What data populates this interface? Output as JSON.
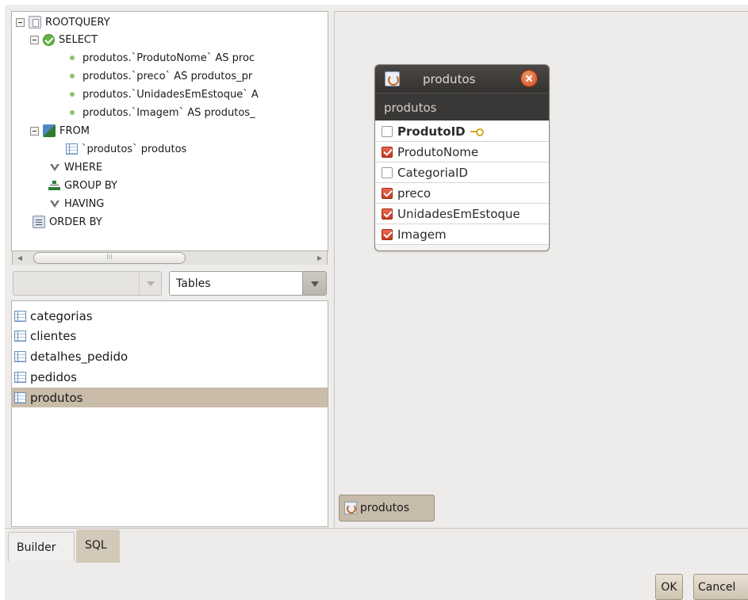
{
  "query_tree": {
    "root": "ROOTQUERY",
    "select": {
      "label": "SELECT",
      "columns": [
        "produtos.`ProdutoNome` AS proc",
        "produtos.`preco` AS produtos_pr",
        "produtos.`UnidadesEmEstoque` A",
        "produtos.`Imagem` AS produtos_"
      ]
    },
    "from": {
      "label": "FROM",
      "tables": [
        "`produtos` produtos"
      ]
    },
    "where": "WHERE",
    "group_by": "GROUP BY",
    "having": "HAVING",
    "order_by": "ORDER BY"
  },
  "scrollbar_grip": "III",
  "schema_combo": {
    "value": ""
  },
  "object_type_combo": {
    "value": "Tables"
  },
  "tables_list": {
    "items": [
      "categorias",
      "clientes",
      "detalhes_pedido",
      "pedidos",
      "produtos"
    ],
    "selected": "produtos"
  },
  "table_node": {
    "title": "produtos",
    "header": "produtos",
    "fields": [
      {
        "name": "ProdutoID",
        "checked": false,
        "primary_key": true
      },
      {
        "name": "ProdutoNome",
        "checked": true,
        "primary_key": false
      },
      {
        "name": "CategoriaID",
        "checked": false,
        "primary_key": false
      },
      {
        "name": "preco",
        "checked": true,
        "primary_key": false
      },
      {
        "name": "UnidadesEmEstoque",
        "checked": true,
        "primary_key": false
      },
      {
        "name": "Imagem",
        "checked": true,
        "primary_key": false
      }
    ]
  },
  "canvas_tab": {
    "label": "produtos"
  },
  "bottom_tabs": {
    "builder": "Builder",
    "sql": "SQL",
    "active": "Builder"
  },
  "buttons": {
    "ok": "OK",
    "cancel": "Cancel"
  },
  "colors": {
    "window_bg": "#edeceb",
    "selection": "#c9bca9",
    "node_titlebar": "#3f3d3b",
    "checkbox_checked": "#d9472a",
    "pk_key": "#d9a520"
  }
}
